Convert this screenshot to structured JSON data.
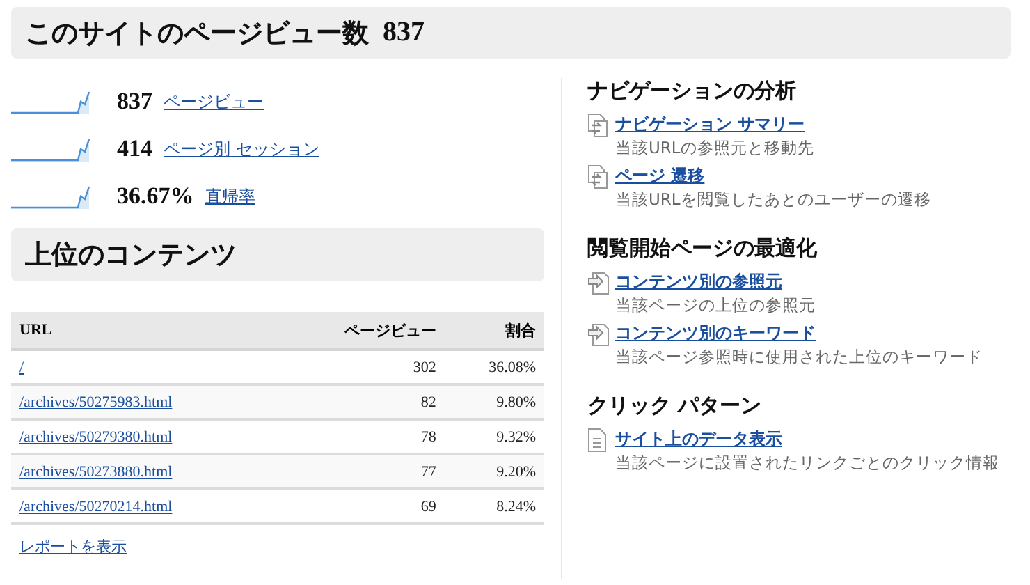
{
  "header": {
    "title": "このサイトのページビュー数",
    "count": "837"
  },
  "metrics": [
    {
      "value": "837",
      "label": "ページビュー"
    },
    {
      "value": "414",
      "label": "ページ別 セッション"
    },
    {
      "value": "36.67%",
      "label": "直帰率"
    }
  ],
  "top_content": {
    "title": "上位のコンテンツ",
    "columns": [
      "URL",
      "ページビュー",
      "割合"
    ],
    "rows": [
      [
        "/",
        "302",
        "36.08%"
      ],
      [
        "/archives/50275983.html",
        "82",
        "9.80%"
      ],
      [
        "/archives/50279380.html",
        "78",
        "9.32%"
      ],
      [
        "/archives/50273880.html",
        "77",
        "9.20%"
      ],
      [
        "/archives/50270214.html",
        "69",
        "8.24%"
      ]
    ],
    "report_link": "レポートを表示"
  },
  "sections": [
    {
      "title": "ナビゲーションの分析",
      "items": [
        {
          "kind": "navigation",
          "link": "ナビゲーション サマリー",
          "description": "当該URLの参照元と移動先"
        },
        {
          "kind": "navigation",
          "link": "ページ 遷移",
          "description": "当該URLを閲覧したあとのユーザーの遷移"
        }
      ]
    },
    {
      "title": "閲覧開始ページの最適化",
      "items": [
        {
          "kind": "entrance",
          "link": "コンテンツ別の参照元",
          "description": "当該ページの上位の参照元"
        },
        {
          "kind": "entrance",
          "link": "コンテンツ別のキーワード",
          "description": "当該ページ参照時に使用された上位のキーワード"
        }
      ]
    },
    {
      "title": "クリック パターン",
      "items": [
        {
          "kind": "overlay",
          "link": "サイト上のデータ表示",
          "description": "当該ページに設置されたリンクごとのクリック情報"
        }
      ]
    }
  ]
}
